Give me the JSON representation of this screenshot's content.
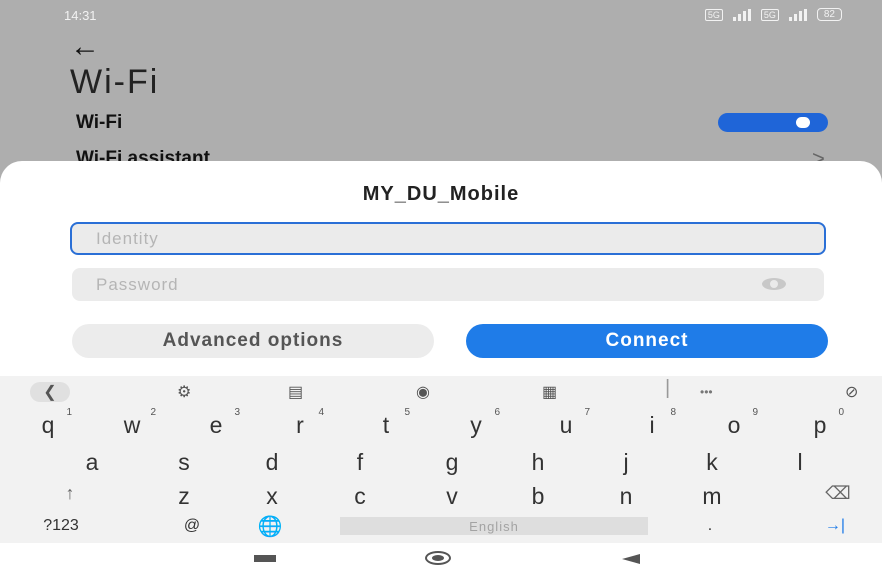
{
  "status_bar": {
    "time": "14:31",
    "sim1": "5G",
    "sim2": "5G",
    "battery": "82"
  },
  "header": {
    "back_icon": "arrow-left-icon",
    "title": "Wi-Fi"
  },
  "settings": {
    "wifi_label": "Wi-Fi",
    "wifi_enabled": true,
    "assistant_label": "Wi-Fi assistant"
  },
  "dialog": {
    "title": "MY_DU_Mobile",
    "identity_placeholder": "Identity",
    "identity_value": "",
    "password_placeholder": "Password",
    "password_value": "",
    "advanced_label": "Advanced options",
    "connect_label": "Connect"
  },
  "keyboard": {
    "toolbar": [
      "chevron-left-icon",
      "gear-icon",
      "translate-icon",
      "palette-icon",
      "clipboard-icon",
      "more-icon",
      "mic-off-icon"
    ],
    "row1": [
      {
        "key": "q",
        "alt": "1"
      },
      {
        "key": "w",
        "alt": "2"
      },
      {
        "key": "e",
        "alt": "3"
      },
      {
        "key": "r",
        "alt": "4"
      },
      {
        "key": "t",
        "alt": "5"
      },
      {
        "key": "y",
        "alt": "6"
      },
      {
        "key": "u",
        "alt": "7"
      },
      {
        "key": "i",
        "alt": "8"
      },
      {
        "key": "o",
        "alt": "9"
      },
      {
        "key": "p",
        "alt": "0"
      }
    ],
    "row2": [
      "a",
      "s",
      "d",
      "f",
      "g",
      "h",
      "j",
      "k",
      "l"
    ],
    "row3": [
      "↑",
      "z",
      "x",
      "c",
      "v",
      "b",
      "n",
      "m",
      "⌫"
    ],
    "row4": {
      "sym": "?123",
      "at": "@",
      "globe": "globe-icon",
      "space": "English",
      "dot": ".",
      "enter": "→|"
    }
  },
  "colors": {
    "accent": "#1f7ce8",
    "toggle": "#1f65d8",
    "dim_background": "#aeaeae"
  }
}
